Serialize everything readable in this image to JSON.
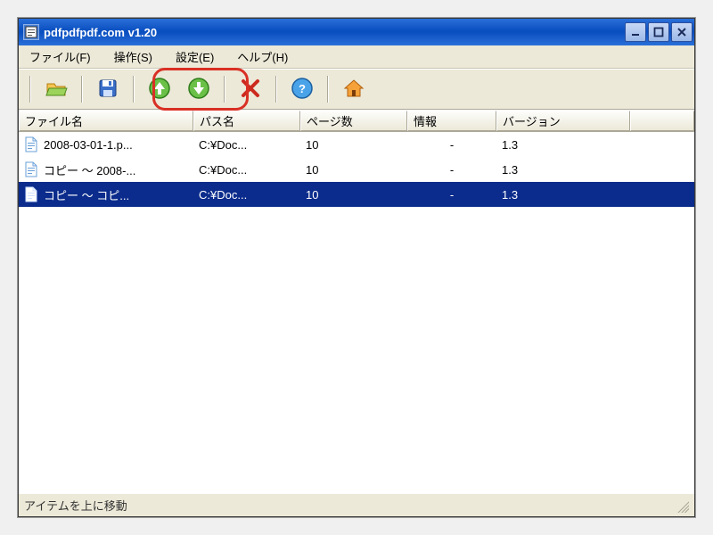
{
  "title": "pdfpdfpdf.com v1.20",
  "menus": {
    "file": "ファイル(F)",
    "action": "操作(S)",
    "settings": "設定(E)",
    "help": "ヘルプ(H)"
  },
  "columns": {
    "filename": "ファイル名",
    "path": "パス名",
    "pages": "ページ数",
    "info": "情報",
    "version": "バージョン"
  },
  "rows": [
    {
      "filename": "2008-03-01-1.p...",
      "path": "C:¥Doc...",
      "pages": "10",
      "info": "-",
      "version": "1.3",
      "selected": false
    },
    {
      "filename": "コピー ～ 2008-...",
      "path": "C:¥Doc...",
      "pages": "10",
      "info": "-",
      "version": "1.3",
      "selected": false
    },
    {
      "filename": "コピー ～ コピ...",
      "path": "C:¥Doc...",
      "pages": "10",
      "info": "-",
      "version": "1.3",
      "selected": true
    }
  ],
  "status": "アイテムを上に移動",
  "icons": {
    "open": "folder-open-icon",
    "save": "save-icon",
    "up": "arrow-up-icon",
    "down": "arrow-down-icon",
    "delete": "delete-icon",
    "help": "help-icon",
    "home": "home-icon"
  }
}
